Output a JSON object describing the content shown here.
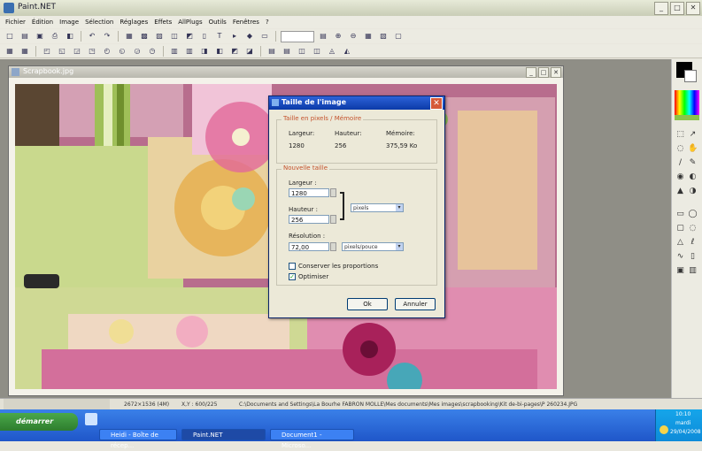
{
  "window": {
    "title": "Paint.NET",
    "min": "_",
    "max": "□",
    "close": "✕"
  },
  "menu": [
    "Fichier",
    "Édition",
    "Image",
    "Sélection",
    "Réglages",
    "Effets",
    "AllPlugs",
    "Outils",
    "Fenêtres",
    "?"
  ],
  "toolbar1": [
    "□",
    "▤",
    "▣",
    "⎙",
    "◧",
    "↶",
    "↷",
    "▦",
    "▩",
    "▨",
    "◫",
    "◩",
    "▯",
    "T",
    "▸",
    "◆",
    "▭",
    "▤",
    "⊕",
    "⊖",
    "▦",
    "▧",
    "▢"
  ],
  "toolbar2": [
    "▦",
    "▦",
    "◰",
    "◱",
    "◲",
    "◳",
    "◴",
    "◵",
    "◶",
    "◷",
    "▥",
    "▥",
    "◨",
    "◧",
    "◩",
    "◪",
    "▤",
    "▤",
    "◫",
    "◫",
    "◬",
    "◭"
  ],
  "image_window": {
    "title": "Scrapbook.jpg"
  },
  "dialog": {
    "title": "Taille de l'image",
    "current_group": "Taille en pixels / Mémoire",
    "current_cols": [
      "Largeur:",
      "Hauteur:",
      "Mémoire:"
    ],
    "current_vals": [
      "1280",
      "256",
      "375,59 Ko"
    ],
    "new_group": "Nouvelle taille",
    "width_label": "Largeur :",
    "width_value": "1280",
    "height_label": "Hauteur :",
    "height_value": "256",
    "units_value": "pixels",
    "resolution_label": "Résolution :",
    "resolution_value": "72,00",
    "res_units_value": "pixels/pouce",
    "keep_proportions": "Conserver les proportions",
    "optimize": "Optimiser",
    "ok": "Ok",
    "cancel": "Annuler"
  },
  "statusbar": {
    "size": "2672×1536 (4M)",
    "pos": "X,Y : 600/225",
    "path": "C:\\Documents and Settings\\La Bourhe FABRON MOLLE\\Mes documents\\Mes images\\scrapbooking\\Kit de-bi-pages\\P 260234.JPG"
  },
  "taskbar": {
    "start": "démarrer",
    "tasks": [
      "Heidi - Boîte de récep...",
      "Paint.NET",
      "Document1 - Microso..."
    ],
    "clock": "10:10",
    "day": "mardi",
    "date": "29/04/2008"
  },
  "colors": {
    "dialog_title": "#0b3aa8",
    "accent": "#c4522c",
    "taskbar": "#2459d0"
  }
}
